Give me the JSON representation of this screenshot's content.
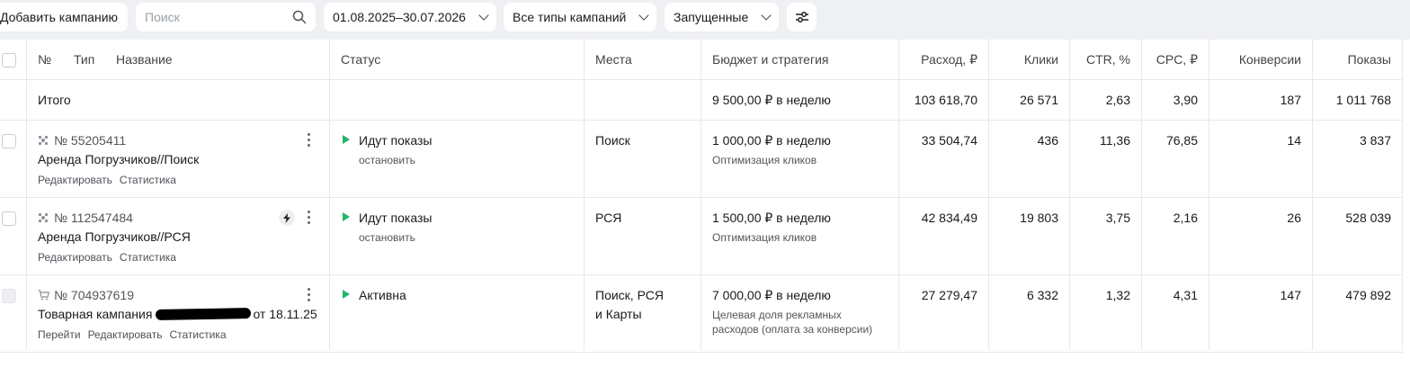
{
  "toolbar": {
    "add_label": "Добавить кампанию",
    "search_placeholder": "Поиск",
    "date_range": "01.08.2025–30.07.2026",
    "campaign_types": "Все типы кампаний",
    "state_filter": "Запущенные"
  },
  "headers": {
    "num": "№",
    "type": "Тип",
    "name": "Название",
    "status": "Статус",
    "places": "Места",
    "budget": "Бюджет и стратегия",
    "spend": "Расход, ₽",
    "clicks": "Клики",
    "ctr": "CTR, %",
    "cpc": "CPC, ₽",
    "conversions": "Конверсии",
    "impressions": "Показы"
  },
  "total": {
    "label": "Итого",
    "budget": "9 500,00 ₽ в неделю",
    "spend": "103 618,70",
    "clicks": "26 571",
    "ctr": "2,63",
    "cpc": "3,90",
    "conversions": "187",
    "impressions": "1 011 768"
  },
  "rows": [
    {
      "number": "№ 55205411",
      "name": "Аренда Погрузчиков//Поиск",
      "links": [
        "Редактировать",
        "Статистика"
      ],
      "status": "Идут показы",
      "status_action": "остановить",
      "places": "Поиск",
      "places2": "",
      "budget": "1 000,00 ₽ в неделю",
      "strategy": "Оптимизация кликов",
      "strategy2": "",
      "spend": "33 504,74",
      "clicks": "436",
      "ctr": "11,36",
      "cpc": "76,85",
      "conversions": "14",
      "impressions": "3 837"
    },
    {
      "number": "№ 112547484",
      "name": "Аренда Погрузчиков//РСЯ",
      "links": [
        "Редактировать",
        "Статистика"
      ],
      "status": "Идут показы",
      "status_action": "остановить",
      "places": "РСЯ",
      "places2": "",
      "budget": "1 500,00 ₽ в неделю",
      "strategy": "Оптимизация кликов",
      "strategy2": "",
      "spend": "42 834,49",
      "clicks": "19 803",
      "ctr": "3,75",
      "cpc": "2,16",
      "conversions": "26",
      "impressions": "528 039"
    },
    {
      "number": "№ 704937619",
      "name_prefix": "Товарная кампания",
      "name_suffix": "от 18.11.25",
      "links": [
        "Перейти",
        "Редактировать",
        "Статистика"
      ],
      "status": "Активна",
      "status_action": "",
      "places": "Поиск, РСЯ",
      "places2": "и Карты",
      "budget": "7 000,00 ₽ в неделю",
      "strategy": "Целевая доля рекламных",
      "strategy2": "расходов (оплата за конверсии)",
      "spend": "27 279,47",
      "clicks": "6 332",
      "ctr": "1,32",
      "cpc": "4,31",
      "conversions": "147",
      "impressions": "479 892"
    }
  ],
  "colors": {
    "toolbar_bg": "#eef0f3",
    "status_green": "#26b36b",
    "grid_line": "#e6e8eb"
  }
}
